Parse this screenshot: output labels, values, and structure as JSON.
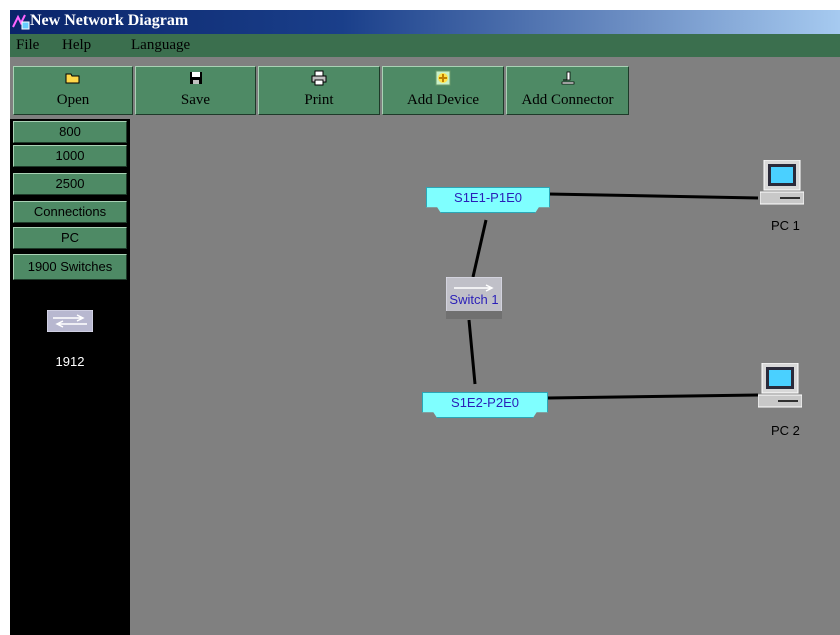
{
  "window": {
    "title": "New Network Diagram"
  },
  "menu": {
    "items": [
      "File",
      "Help",
      "Language"
    ]
  },
  "toolbar": {
    "buttons": [
      {
        "label": "Open",
        "icon": "folder-icon"
      },
      {
        "label": "Save",
        "icon": "floppy-disk-icon"
      },
      {
        "label": "Print",
        "icon": "printer-icon"
      },
      {
        "label": "Add Device",
        "icon": "add-device-icon"
      },
      {
        "label": "Add Connector",
        "icon": "add-connector-icon"
      }
    ]
  },
  "sidebar": {
    "categories": [
      "800",
      "1000",
      "2500",
      "Connections",
      "PC",
      "1900 Switches"
    ],
    "devices": [
      {
        "label": "1912",
        "icon": "switch-icon"
      }
    ]
  },
  "canvas": {
    "ports": [
      "S1E1-P1E0",
      "S1E2-P2E0"
    ],
    "switch_label": "Switch 1",
    "pcs": [
      {
        "label": "PC 1"
      },
      {
        "label": "PC 2"
      }
    ]
  },
  "colors": {
    "background": "#808080",
    "button": "#4e8a65",
    "menubar": "#3b6f4e",
    "sidebar": "#000000",
    "port": "#7fffff",
    "link_text": "#2a1fb8"
  }
}
